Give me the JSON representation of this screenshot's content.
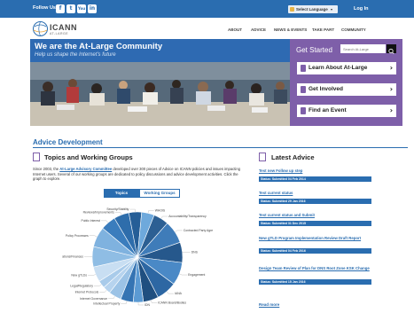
{
  "topbar": {
    "follow_label": "Follow Us:",
    "social_icons": [
      "f",
      "t",
      "You",
      "in"
    ],
    "language_select": "Select Language",
    "login": "Log In"
  },
  "logo": {
    "text": "ICANN",
    "sub": "AT-LARGE"
  },
  "nav": [
    "ABOUT",
    "ADVICE",
    "NEWS & EVENTS",
    "TAKE PART",
    "COMMUNITY"
  ],
  "hero": {
    "title": "We are the At-Large Community",
    "subtitle": "Help us shape the Internet's future"
  },
  "get_started": {
    "title": "Get Started",
    "search_placeholder": "Search At-Large",
    "items": [
      {
        "label": "Learn About At-Large"
      },
      {
        "label": "Get Involved"
      },
      {
        "label": "Find an Event"
      }
    ]
  },
  "advice": {
    "section_title": "Advice Development",
    "topics_title": "Topics and Working Groups",
    "desc_prefix": "Since 2003, the ",
    "desc_link": "At-Large Advisory Committee",
    "desc_suffix": " developed over 300 pieces of Advice on ICANN policies and issues impacting Internet users. Several of our working groups are dedicated to policy discussions and advice development activities. Click the graph to explore.",
    "toggle_topics": "Topics",
    "toggle_wg": "Working Groups"
  },
  "chart_data": {
    "type": "pie",
    "slices": [
      {
        "label": "Accountability/Transparency",
        "value": 6,
        "color": "#2c5f93"
      },
      {
        "label": "Contracted Party Agreements",
        "value": 9,
        "color": "#3f7cb9"
      },
      {
        "label": "DNS",
        "value": 8,
        "color": "#26588c"
      },
      {
        "label": "Engagement",
        "value": 9,
        "color": "#4a89c6"
      },
      {
        "label": "IANA",
        "value": 8,
        "color": "#2d67a3"
      },
      {
        "label": "ICANN Board/Bodies",
        "value": 6,
        "color": "#1f4f80"
      },
      {
        "label": "IDN",
        "value": 4,
        "color": "#5b9ad3"
      },
      {
        "label": "Intellectual Property",
        "value": 5,
        "color": "#3574b3"
      },
      {
        "label": "Internet Governance",
        "value": 5,
        "color": "#9cc3e6"
      },
      {
        "label": "Internet Protocols",
        "value": 3,
        "color": "#b6d3ee"
      },
      {
        "label": "Legal/Regulatory",
        "value": 3,
        "color": "#a9cbea"
      },
      {
        "label": "New gTLDs",
        "value": 6,
        "color": "#c8def2"
      },
      {
        "label": "Operations/Finances",
        "value": 8,
        "color": "#8fbde4"
      },
      {
        "label": "Policy Processes",
        "value": 8,
        "color": "#7fb2df"
      },
      {
        "label": "Public Interest",
        "value": 6,
        "color": "#3b7dbd"
      },
      {
        "label": "Reviews/Improvements",
        "value": 6,
        "color": "#2e6dab"
      },
      {
        "label": "Security/Stability",
        "value": 5,
        "color": "#255e97"
      },
      {
        "label": "WHOIS",
        "value": 5,
        "color": "#6ea9dc"
      }
    ]
  },
  "latest_advice": {
    "title": "Latest Advice",
    "items": [
      {
        "title": "Test new Follow up step",
        "status": "Status: Submitted  04 Feb 2014"
      },
      {
        "title": "Test current status",
        "status": "Status: Submitted  29 Jan 2016"
      },
      {
        "title": "Test current status and Submit",
        "status": "Status: Submitted  31 Dec 2015"
      },
      {
        "title": "New gTLD Program Implementation Review Draft Report",
        "status": "Status: Submitted  04 Feb 2016"
      },
      {
        "title": "Design Team Review of Plan for DNS Root Zone KSK Change",
        "status": "Status: Submitted  15 Jan 2016"
      }
    ],
    "read_more": "Read more"
  }
}
